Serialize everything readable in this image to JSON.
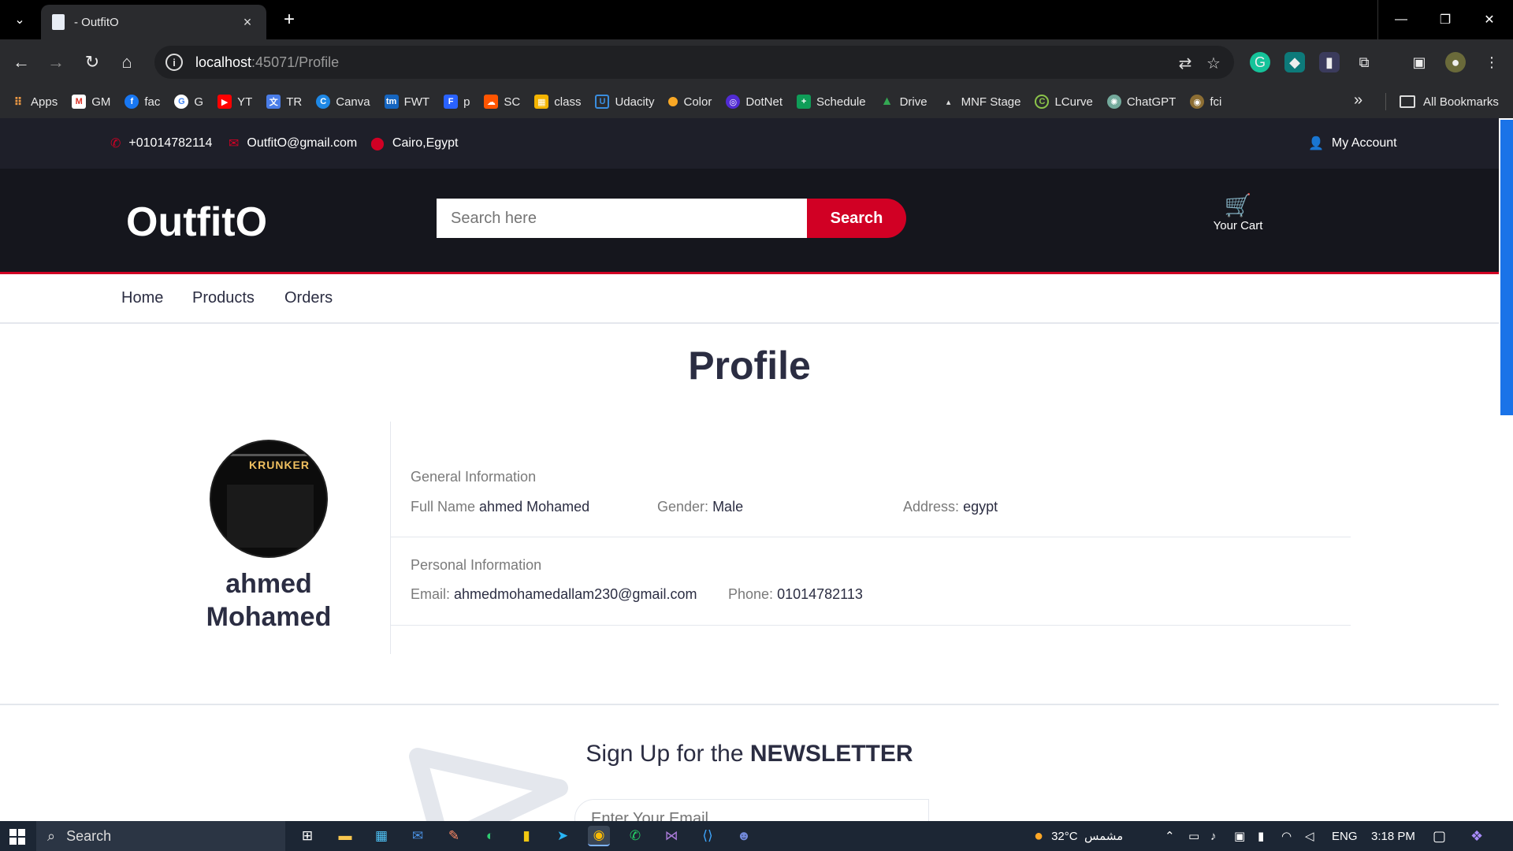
{
  "browser": {
    "tab_title": "- OutfitO",
    "url_host": "localhost",
    "url_rest": ":45071/Profile",
    "bookmarks": [
      "Apps",
      "GM",
      "fac",
      "G",
      "YT",
      "TR",
      "Canva",
      "FWT",
      "p",
      "SC",
      "class",
      "Udacity",
      "Color",
      "DotNet",
      "Schedule",
      "Drive",
      "MNF Stage",
      "LCurve",
      "ChatGPT",
      "fci"
    ],
    "all_bookmarks": "All Bookmarks"
  },
  "topbar": {
    "phone": "+01014782114",
    "email": "OutfitO@gmail.com",
    "location": "Cairo,Egypt",
    "account": "My Account"
  },
  "header": {
    "logo": "OutfitO",
    "search_placeholder": "Search here",
    "search_button": "Search",
    "cart_label": "Your Cart"
  },
  "nav": [
    "Home",
    "Products",
    "Orders"
  ],
  "profile": {
    "title": "Profile",
    "name_first": "ahmed",
    "name_last": "Mohamed",
    "avatar_text": "KRUNKER",
    "general": {
      "heading": "General Information",
      "full_name_label": "Full Name",
      "full_name": "ahmed Mohamed",
      "gender_label": "Gender:",
      "gender": "Male",
      "address_label": "Address:",
      "address": "egypt"
    },
    "personal": {
      "heading": "Personal Information",
      "email_label": "Email:",
      "email": "ahmedmohamedallam230@gmail.com",
      "phone_label": "Phone:",
      "phone": "01014782113"
    }
  },
  "newsletter": {
    "title_prefix": "Sign Up for the",
    "title_bold": "NEWSLETTER",
    "placeholder": "Enter Your Email"
  },
  "taskbar": {
    "search": "Search",
    "weather": "32°C",
    "weather_desc": "مشمس",
    "lang": "ENG",
    "time": "3:18 PM"
  },
  "colors": {
    "accent": "#d10024",
    "header_bg": "#15161d",
    "topbar_bg": "#1e1f29",
    "text_dark": "#2b2d42"
  }
}
